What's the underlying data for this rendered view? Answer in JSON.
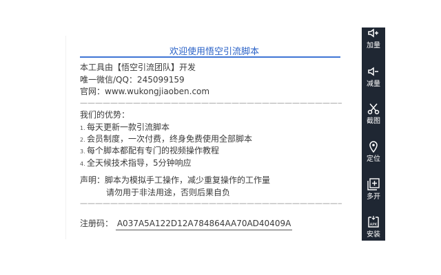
{
  "dialog": {
    "title": "欢迎使用悟空引流脚本",
    "intro_lines": [
      "本工具由【悟空引流团队】开发",
      "唯一微信/QQ：245099159",
      "官网：www.wukongjiaoben.com"
    ],
    "separator": "——————————————————————————————————————————",
    "advantages_heading": "我们的优势：",
    "advantages": [
      {
        "num": "1.",
        "text": "每天更新一款引流脚本"
      },
      {
        "num": "2.",
        "text": "会员制度，一次付费，终身免费使用全部脚本"
      },
      {
        "num": "3.",
        "text": "每个脚本都配有专门的视频操作教程"
      },
      {
        "num": "4.",
        "text": "全天候技术指导，5分钟响应"
      }
    ],
    "statement_line1": "声明：脚本为模拟手工操作，减少重复操作的工作量",
    "statement_line2": "请勿用于非法用途，否则后果自负",
    "reg_label": "注册码：",
    "reg_code": "A037A5A122D12A784864AA70AD40409A"
  },
  "toolbar": {
    "items": [
      {
        "label": "加量",
        "icon": "volume-up-icon"
      },
      {
        "label": "减量",
        "icon": "volume-down-icon"
      },
      {
        "label": "截图",
        "icon": "scissors-icon"
      },
      {
        "label": "定位",
        "icon": "location-pin-icon"
      },
      {
        "label": "多开",
        "icon": "multi-window-icon"
      },
      {
        "label": "安装",
        "icon": "apk-install-icon"
      }
    ]
  },
  "colors": {
    "title": "#2a62c7",
    "rule": "#3d74d4",
    "toolbar_bg": "#1f2733"
  }
}
